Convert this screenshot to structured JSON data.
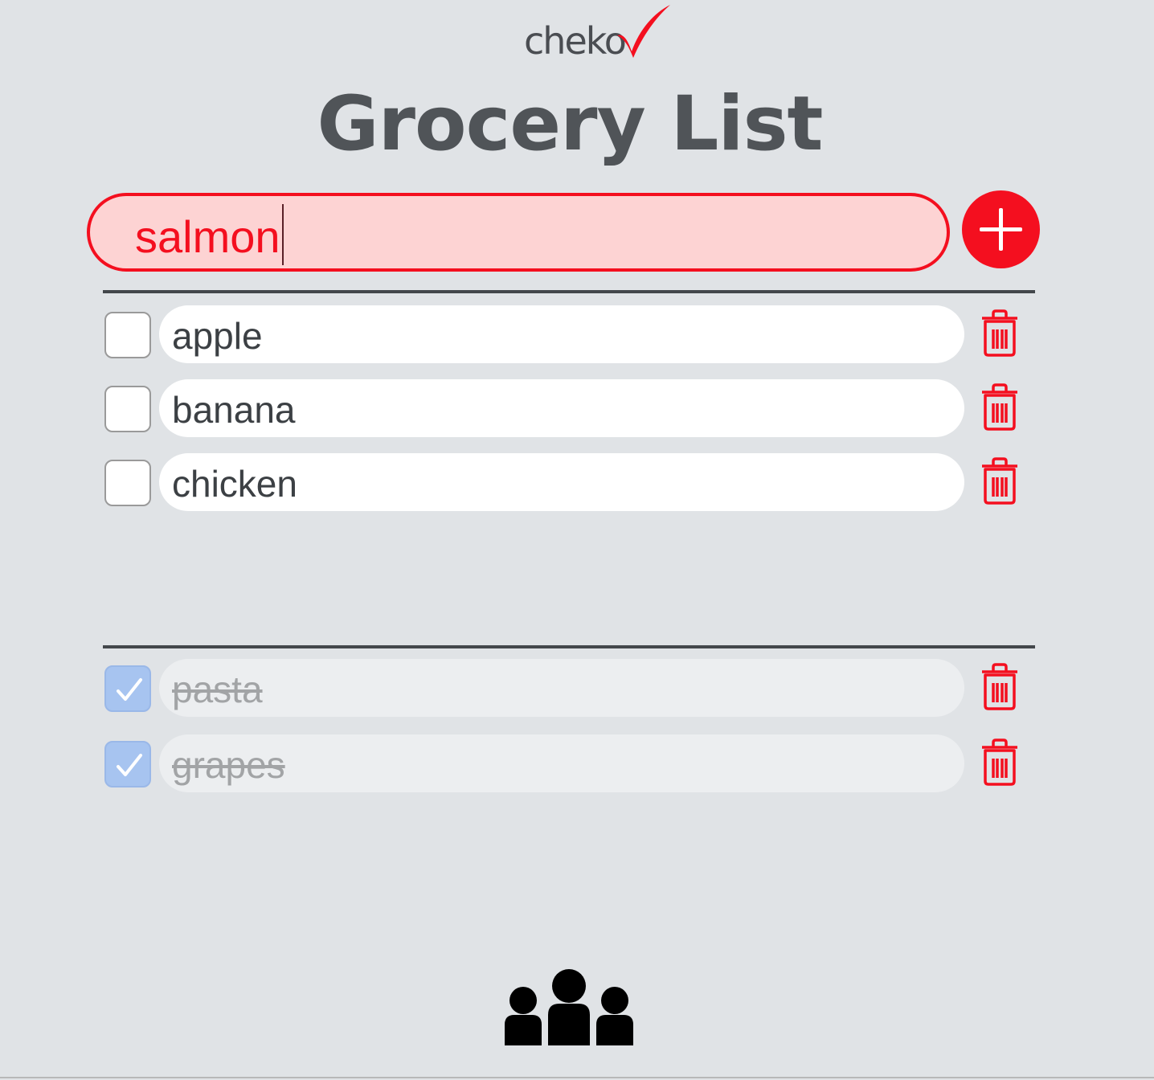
{
  "logo": {
    "text": "cheko",
    "check_color": "#f40f1f"
  },
  "title": "Grocery List",
  "new_item": {
    "value": "salmon",
    "placeholder": ""
  },
  "add_button": {
    "icon": "plus-icon"
  },
  "active_items": [
    {
      "label": "apple",
      "checked": false
    },
    {
      "label": "banana",
      "checked": false
    },
    {
      "label": "chicken",
      "checked": false
    }
  ],
  "completed_items": [
    {
      "label": "pasta",
      "checked": true
    },
    {
      "label": "grapes",
      "checked": true
    }
  ],
  "footer": {
    "icon": "group-icon"
  },
  "colors": {
    "accent": "#f40f1f",
    "background": "#e0e3e6",
    "input_bg": "#fdd3d3",
    "checked_box": "#a7c4f0"
  }
}
